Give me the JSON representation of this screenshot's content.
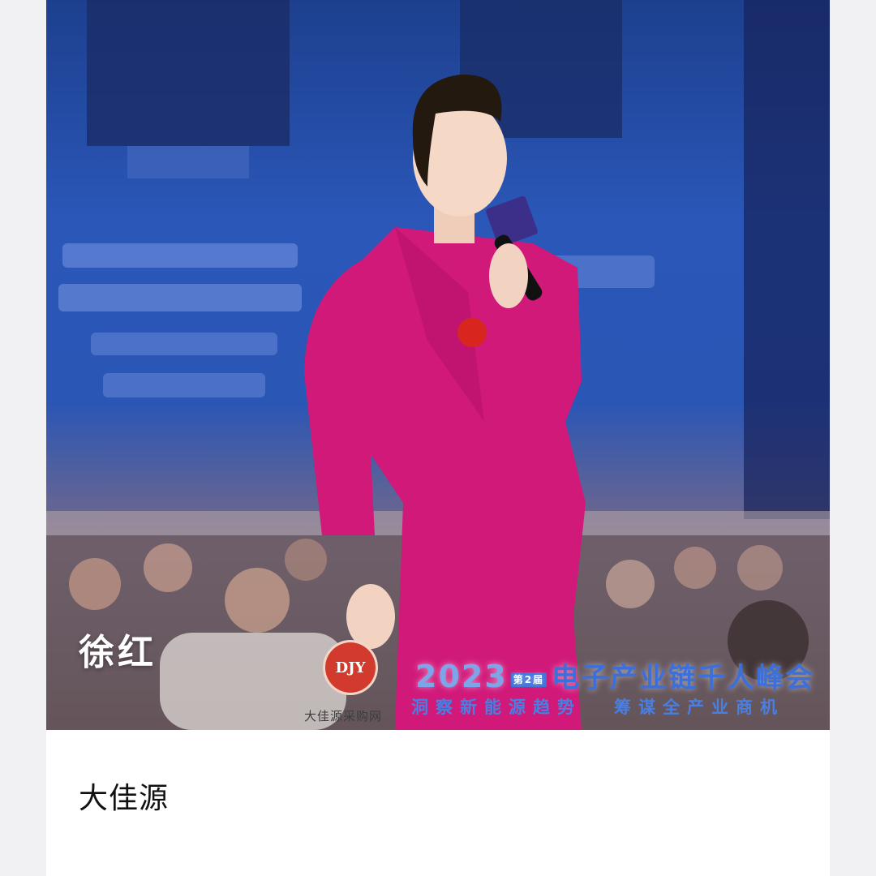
{
  "post": {
    "speaker_name": "徐红",
    "author": "大佳源"
  },
  "watermark": {
    "badge_text": "DJY",
    "caption": "大佳源采购网"
  },
  "event": {
    "year": "2023",
    "tag": "第2届",
    "title": "电子产业链千人峰会",
    "slogan_left": "洞察新能源趋势",
    "slogan_right": "筹谋全产业商机"
  },
  "colors": {
    "accent_blue": "#3c6fd8",
    "suit_magenta": "#d1197a",
    "brand_red": "#d23a2e"
  }
}
